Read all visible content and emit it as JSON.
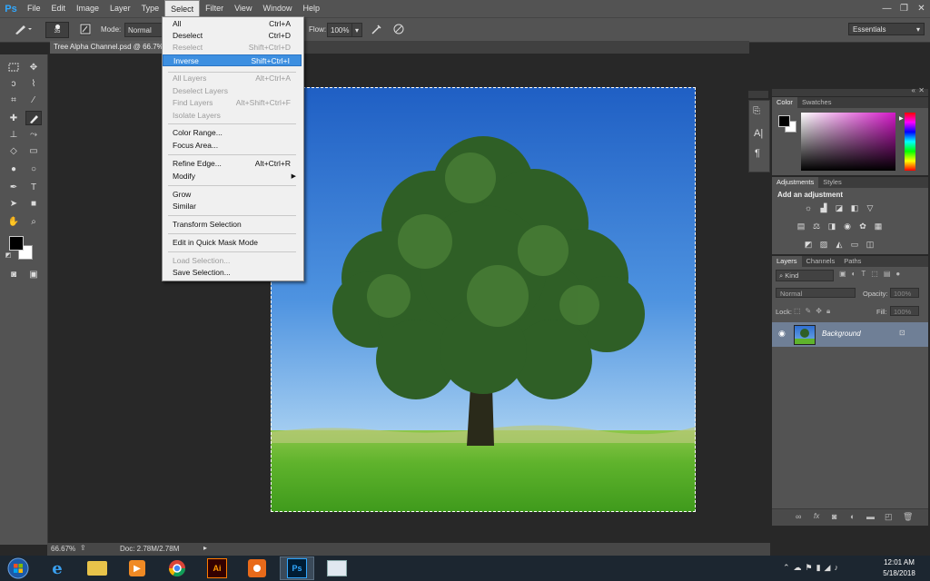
{
  "app": {
    "logo": "Ps",
    "menu": [
      "File",
      "Edit",
      "Image",
      "Layer",
      "Type",
      "Select",
      "Filter",
      "View",
      "Window",
      "Help"
    ],
    "active_menu": "Select",
    "window_controls": [
      "—",
      "❐",
      "✕"
    ]
  },
  "options_bar": {
    "brush_size": "35",
    "mode_label": "Mode:",
    "mode_value": "Normal",
    "flow_label": "Flow:",
    "flow_value": "100%",
    "workspace": "Essentials"
  },
  "document": {
    "tab_title": "Tree Alpha Channel.psd @ 66.7%"
  },
  "select_menu": {
    "items": [
      {
        "label": "All",
        "shortcut": "Ctrl+A",
        "state": "enabled"
      },
      {
        "label": "Deselect",
        "shortcut": "Ctrl+D",
        "state": "enabled"
      },
      {
        "label": "Reselect",
        "shortcut": "Shift+Ctrl+D",
        "state": "disabled"
      },
      {
        "label": "Inverse",
        "shortcut": "Shift+Ctrl+I",
        "state": "highlighted"
      },
      {
        "label": "All Layers",
        "shortcut": "Alt+Ctrl+A",
        "state": "disabled"
      },
      {
        "label": "Deselect Layers",
        "shortcut": "",
        "state": "disabled"
      },
      {
        "label": "Find Layers",
        "shortcut": "Alt+Shift+Ctrl+F",
        "state": "disabled"
      },
      {
        "label": "Isolate Layers",
        "shortcut": "",
        "state": "disabled"
      },
      {
        "label": "Color Range...",
        "shortcut": "",
        "state": "enabled"
      },
      {
        "label": "Focus Area...",
        "shortcut": "",
        "state": "enabled"
      },
      {
        "label": "Refine Edge...",
        "shortcut": "Alt+Ctrl+R",
        "state": "enabled"
      },
      {
        "label": "Modify",
        "shortcut": "",
        "state": "submenu"
      },
      {
        "label": "Grow",
        "shortcut": "",
        "state": "enabled"
      },
      {
        "label": "Similar",
        "shortcut": "",
        "state": "enabled"
      },
      {
        "label": "Transform Selection",
        "shortcut": "",
        "state": "enabled"
      },
      {
        "label": "Edit in Quick Mask Mode",
        "shortcut": "",
        "state": "enabled"
      },
      {
        "label": "Load Selection...",
        "shortcut": "",
        "state": "disabled"
      },
      {
        "label": "Save Selection...",
        "shortcut": "",
        "state": "enabled"
      }
    ]
  },
  "status": {
    "zoom": "66.67%",
    "doc_size": "Doc: 2.78M/2.78M"
  },
  "panels": {
    "color_tabs": [
      "Color",
      "Swatches"
    ],
    "adjustments_tabs": [
      "Adjustments",
      "Styles"
    ],
    "add_adjustment": "Add an adjustment",
    "layers_tabs": [
      "Layers",
      "Channels",
      "Paths"
    ],
    "kind_label": "Kind",
    "blend_mode": "Normal",
    "opacity_label": "Opacity:",
    "opacity_value": "100%",
    "lock_label": "Lock:",
    "fill_label": "Fill:",
    "fill_value": "100%",
    "layer_name": "Background"
  },
  "taskbar": {
    "time": "12:01 AM",
    "date": "5/18/2018"
  },
  "colors": {
    "foreground": "#000000",
    "background": "#ffffff",
    "highlight": "#3d8fe0",
    "ui_panel": "#535353"
  }
}
